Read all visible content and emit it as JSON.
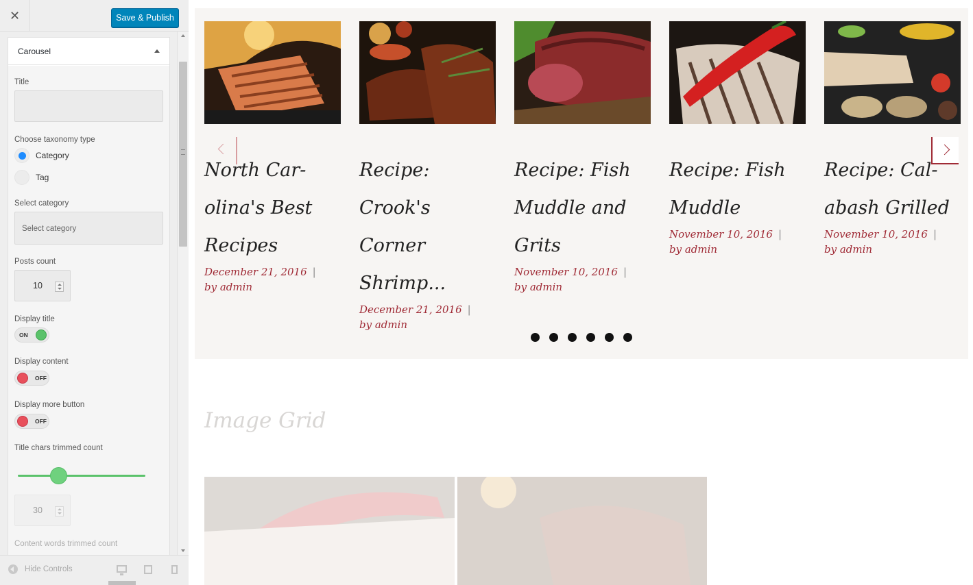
{
  "header": {
    "close_icon": "close-icon",
    "publish_label": "Save & Publish"
  },
  "section": {
    "title": "Carousel"
  },
  "fields": {
    "title_label": "Title",
    "taxonomy_label": "Choose taxonomy type",
    "taxonomy_options": [
      "Category",
      "Tag"
    ],
    "taxonomy_selected": "Category",
    "select_category_label": "Select category",
    "select_category_placeholder": "Select category",
    "posts_count_label": "Posts count",
    "posts_count_value": "10",
    "display_title_label": "Display title",
    "display_title_state": "ON",
    "display_content_label": "Display content",
    "display_content_state": "OFF",
    "display_more_label": "Display more button",
    "display_more_state": "OFF",
    "title_trim_label": "Title chars trimmed count",
    "title_trim_slider": 0.33,
    "title_trim_value": "30",
    "content_trim_label": "Content words trimmed count"
  },
  "footer": {
    "hide_controls": "Hide Controls"
  },
  "carousel": {
    "slides": [
      {
        "title": "North Car-olina's Best Recipes",
        "title_lines": [
          "North Car-",
          "olina's Best",
          "Recipes"
        ],
        "date": "December 21, 2016",
        "author": "by admin",
        "image": "grilled-salmon"
      },
      {
        "title": "Recipe: Crook's Corner Shrimp...",
        "title_lines": [
          "Recipe: Crook's",
          "Corner",
          "Shrimp..."
        ],
        "date": "December 21, 2016",
        "author": "by admin",
        "image": "bbq-ribs"
      },
      {
        "title": "Recipe: Fish Muddle and Grits",
        "title_lines": [
          "Recipe: Fish",
          "Muddle and",
          "Grits"
        ],
        "date": "November 10, 2016",
        "author": "by admin",
        "image": "steak"
      },
      {
        "title": "Recipe: Fish Muddle",
        "title_lines": [
          "Recipe: Fish",
          "Muddle"
        ],
        "date": "November 10, 2016",
        "author": "by admin",
        "image": "fish-with-chili"
      },
      {
        "title": "Recipe: Cal-abash Grilled",
        "title_lines": [
          "Recipe: Cal-",
          "abash Grilled"
        ],
        "date": "November 10, 2016",
        "author": "by admin",
        "image": "grilled-vegetables"
      }
    ],
    "dot_count": 6
  },
  "image_grid": {
    "heading": "Image Grid"
  },
  "colors": {
    "accent": "#a02b36",
    "button": "#0085ba",
    "on": "#5ac26a",
    "off": "#e8505b"
  }
}
